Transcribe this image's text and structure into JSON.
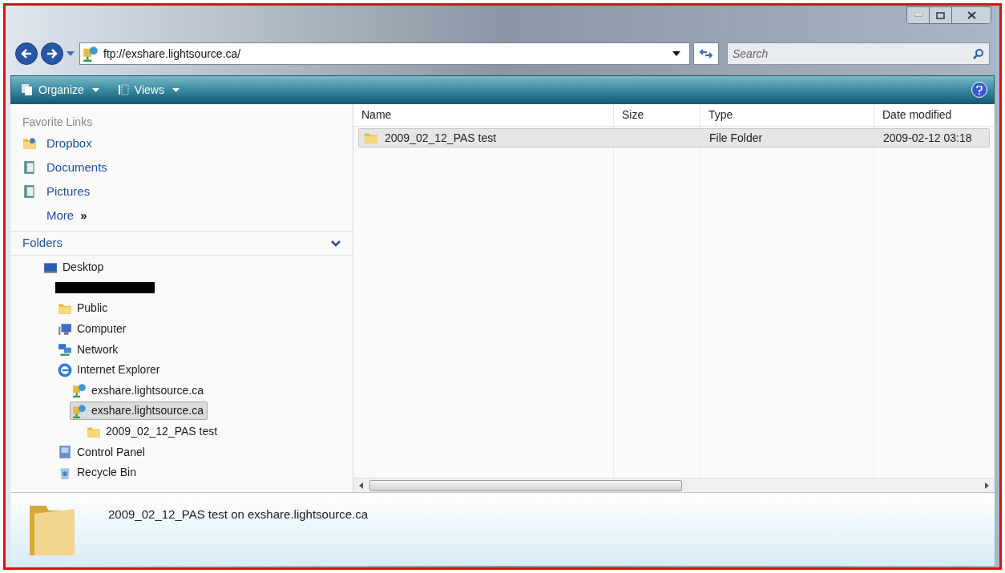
{
  "address_bar": {
    "value": "ftp://exshare.lightsource.ca/"
  },
  "search": {
    "placeholder": "Search"
  },
  "toolbar": {
    "buttons": [
      {
        "label": "Organize",
        "kind": "organize"
      },
      {
        "label": "Views",
        "kind": "views"
      }
    ]
  },
  "favorite_links": {
    "title": "Favorite Links",
    "items": [
      {
        "label": "Dropbox",
        "kind": "dropbox"
      },
      {
        "label": "Documents",
        "kind": "documents"
      },
      {
        "label": "Pictures",
        "kind": "pictures"
      }
    ],
    "more": "More",
    "more_glyph": "»"
  },
  "folders": {
    "title": "Folders",
    "expanded": true,
    "items": [
      {
        "label": "Desktop",
        "kind": "desktop",
        "selected": false,
        "children": [
          {
            "kind": "redacted"
          },
          {
            "label": "Public",
            "kind": "folder",
            "selected": false
          },
          {
            "label": "Computer",
            "kind": "computer",
            "selected": false
          },
          {
            "label": "Network",
            "kind": "network",
            "selected": false
          },
          {
            "label": "Internet Explorer",
            "kind": "ie",
            "selected": false,
            "children": [
              {
                "label": "exshare.lightsource.ca",
                "kind": "ftp",
                "selected": false
              },
              {
                "label": "exshare.lightsource.ca",
                "kind": "ftp",
                "selected": true,
                "children": [
                  {
                    "label": "2009_02_12_PAS test",
                    "kind": "folder",
                    "selected": false
                  }
                ]
              }
            ]
          },
          {
            "label": "Control Panel",
            "kind": "control",
            "selected": false
          },
          {
            "label": "Recycle Bin",
            "kind": "recycle",
            "selected": false
          }
        ]
      }
    ]
  },
  "table": {
    "columns": [
      "Name",
      "Size",
      "Type",
      "Date modified"
    ],
    "rows": [
      {
        "name": "2009_02_12_PAS test",
        "type": "File Folder",
        "date_modified": "2009-02-12 03:18",
        "selected": true
      }
    ]
  },
  "details": {
    "text": "2009_02_12_PAS test on exshare.lightsource.ca"
  }
}
